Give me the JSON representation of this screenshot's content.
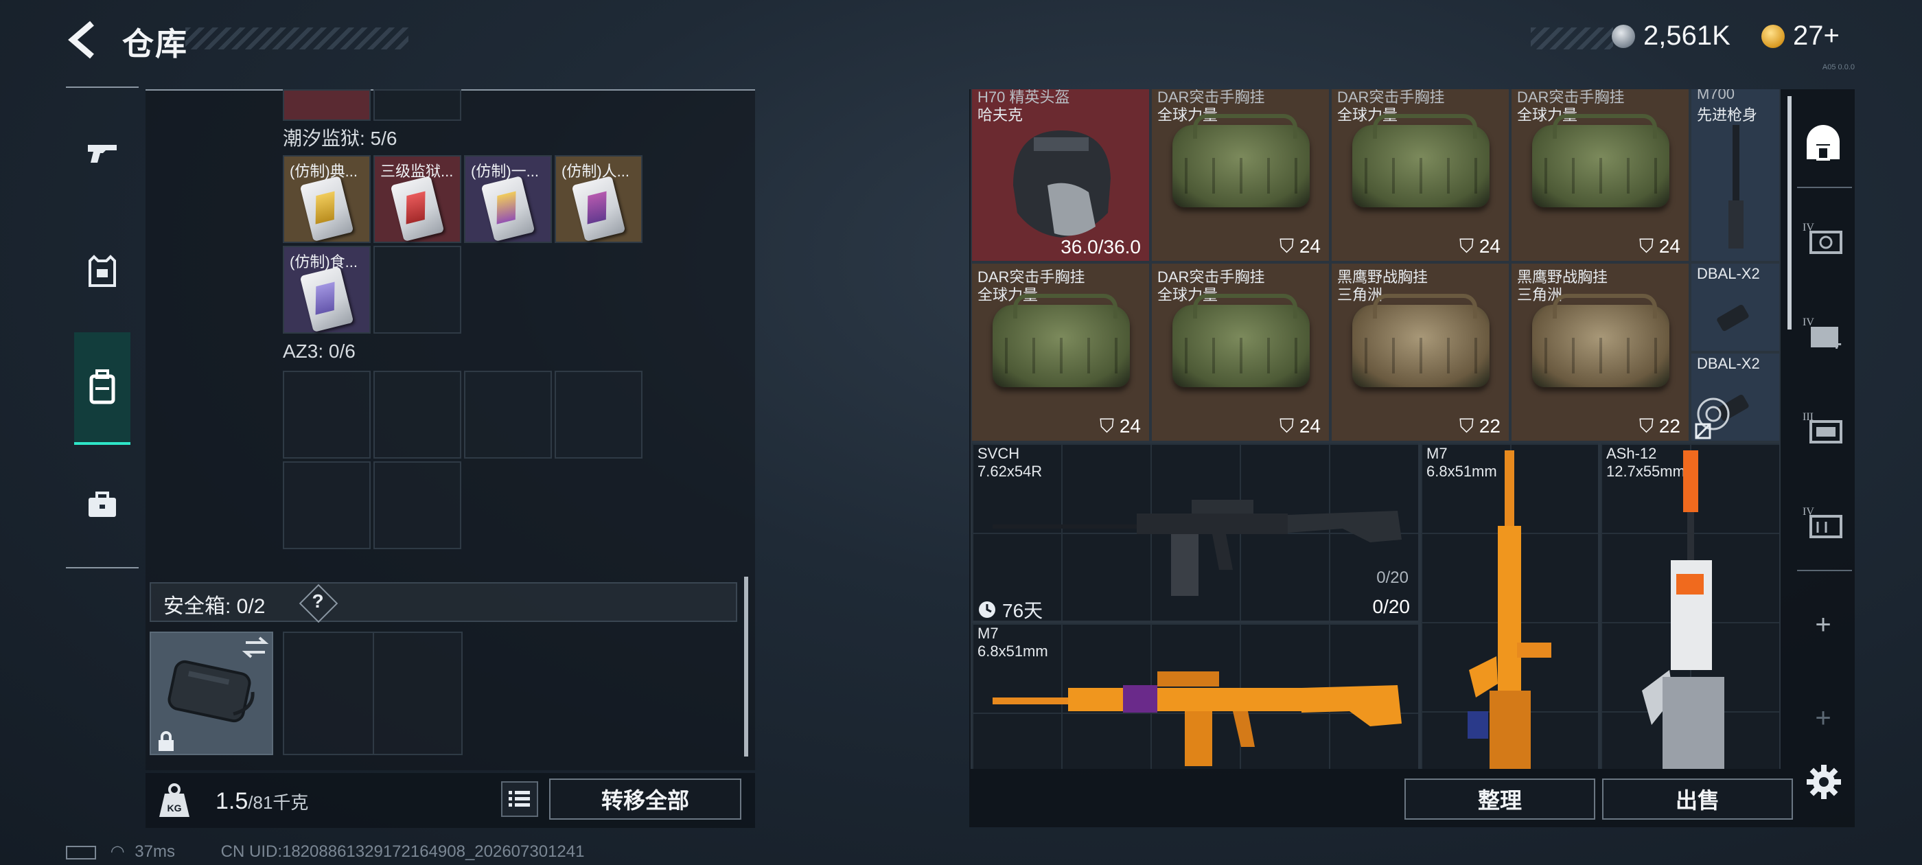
{
  "header": {
    "title": "仓库",
    "currency": [
      {
        "icon": "silver-coin-icon",
        "value": "2,561K"
      },
      {
        "icon": "gold-coin-icon",
        "value": "27+"
      }
    ],
    "version": "A05 0.0.0"
  },
  "sidebar_left": [
    {
      "icon": "gun-icon",
      "active": false
    },
    {
      "icon": "armor-icon",
      "active": false
    },
    {
      "icon": "backpack-icon",
      "active": true
    },
    {
      "icon": "briefcase-icon",
      "active": false
    }
  ],
  "containers": [
    {
      "label": "潮汐监狱: 5/6",
      "items": [
        "(仿制)典...",
        "三级监狱...",
        "(仿制)一...",
        "(仿制)人...",
        "(仿制)食..."
      ]
    },
    {
      "label": "AZ3: 0/6"
    }
  ],
  "safe_box": {
    "label": "安全箱: 0/2",
    "help": "?"
  },
  "bottom_left": {
    "weight": "1.5",
    "weight_max": "/81千克",
    "weight_icon_text": "KG",
    "transfer_all": "转移全部"
  },
  "status": {
    "ping": "37ms",
    "uid": "CN UID:18208861329172164908_202607301241"
  },
  "stash": {
    "helmet": {
      "name": "H70 精英头盔",
      "sub": "哈夫克",
      "durability": "36.0/36.0"
    },
    "rigs": [
      {
        "name": "DAR突击手胸挂",
        "sub": "全球力量",
        "count": "24"
      },
      {
        "name": "DAR突击手胸挂",
        "sub": "全球力量",
        "count": "24"
      },
      {
        "name": "DAR突击手胸挂",
        "sub": "全球力量",
        "count": "24"
      },
      {
        "name": "DAR突击手胸挂",
        "sub": "全球力量",
        "count": "24"
      },
      {
        "name": "DAR突击手胸挂",
        "sub": "全球力量",
        "count": "24"
      },
      {
        "name": "黑鹰野战胸挂",
        "sub": "三角洲",
        "count": "22"
      },
      {
        "name": "黑鹰野战胸挂",
        "sub": "三角洲",
        "count": "22"
      }
    ],
    "m700": {
      "name": "M700",
      "sub": "先进枪身"
    },
    "dbal": [
      {
        "name": "DBAL-X2"
      },
      {
        "name": "DBAL-X2"
      }
    ],
    "weapons": [
      {
        "name": "SVCH",
        "caliber": "7.62x54R",
        "ammo1": "0/20",
        "ammo2": "0/20",
        "timer": "76天"
      },
      {
        "name": "M7",
        "caliber": "6.8x51mm"
      },
      {
        "name": "ASh-12",
        "caliber": "12.7x55mm"
      },
      {
        "name": "M7",
        "caliber": "6.8x51mm"
      }
    ],
    "sort_button": "整理",
    "sell_button": "出售"
  },
  "right_tabs": [
    {
      "icon": "stash-home-icon"
    },
    {
      "icon": "stash-tab-4-icon",
      "label": "IV"
    },
    {
      "icon": "stash-tab-4-plus-icon",
      "label": "IV"
    },
    {
      "icon": "stash-tab-3-icon",
      "label": "III"
    },
    {
      "icon": "stash-tab-4b-icon",
      "label": "IV"
    },
    {
      "icon": "add-tab-icon",
      "label": "+"
    },
    {
      "icon": "add-tab-icon",
      "label": "+"
    }
  ],
  "colors": {
    "accent": "#2ee6c8",
    "helmet_bg": "#6b2a30",
    "rig_bg": "#4a3a2e",
    "blue_bg": "#2c3a4c",
    "gold_card_bg": "#5b4a32",
    "red_card_bg": "#5a2a32",
    "purple_card_bg": "#3a3456"
  }
}
